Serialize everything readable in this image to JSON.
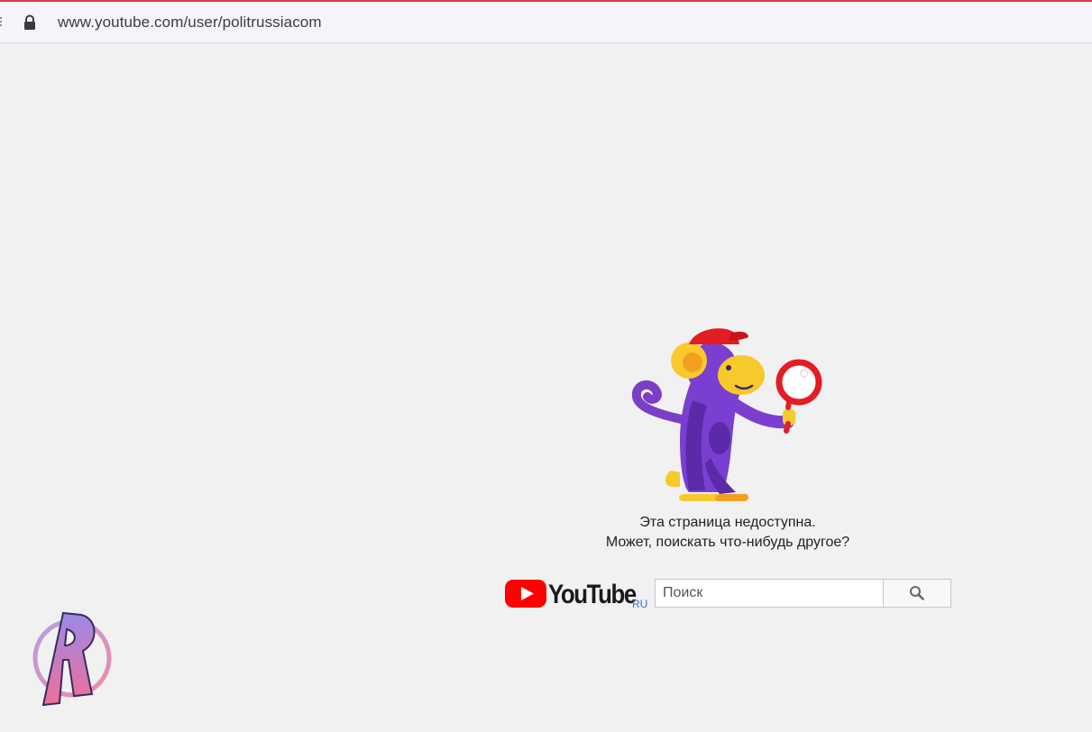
{
  "browser": {
    "url": "www.youtube.com/user/politrussiacom",
    "lock_icon": "lock-icon",
    "accent_color": "#d23a4a"
  },
  "error": {
    "illustration": "monkey-with-magnifier-icon",
    "line1": "Эта страница недоступна.",
    "line2": "Может, поискать что-нибудь другое?"
  },
  "brand": {
    "logo_text": "YouTube",
    "region": "RU",
    "play_color": "#ff0000"
  },
  "search": {
    "placeholder": "Поиск",
    "value": "",
    "button_icon": "search-icon"
  },
  "watermark": {
    "logo_letter": "R"
  }
}
